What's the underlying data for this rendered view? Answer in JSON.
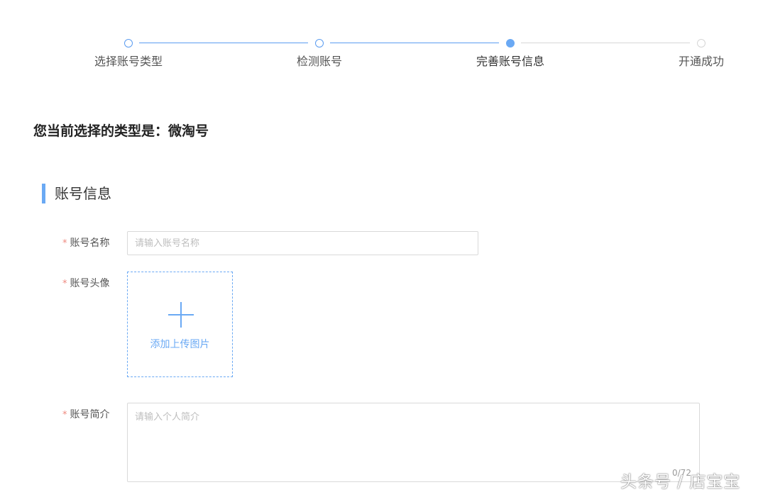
{
  "steps": [
    {
      "label": "选择账号类型",
      "status": "done"
    },
    {
      "label": "检测账号",
      "status": "done"
    },
    {
      "label": "完善账号信息",
      "status": "active"
    },
    {
      "label": "开通成功",
      "status": "pending"
    }
  ],
  "colors": {
    "accent": "#6aa9f4",
    "required": "#ef8a7f",
    "line_pending": "#d6d6d6"
  },
  "type_heading": "您当前选择的类型是：微淘号",
  "section": {
    "title": "账号信息"
  },
  "form": {
    "required_mark": "*",
    "name": {
      "label": "账号名称",
      "placeholder": "请输入账号名称",
      "value": ""
    },
    "avatar": {
      "label": "账号头像",
      "upload_text": "添加上传图片",
      "icon": "plus-icon"
    },
    "intro": {
      "label": "账号简介",
      "placeholder": "请输入个人简介",
      "value": "",
      "counter": "0/72"
    }
  },
  "watermark": "头条号 / 店宝宝"
}
